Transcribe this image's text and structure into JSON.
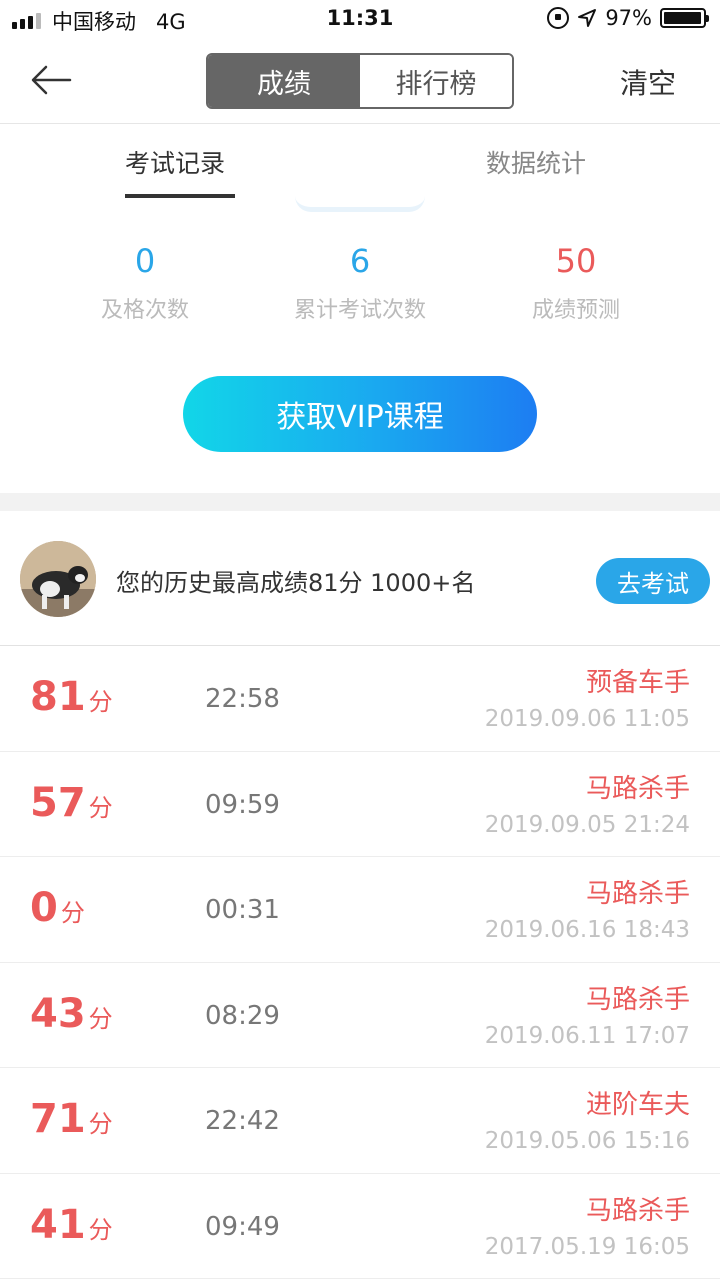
{
  "status_bar": {
    "carrier": "中国移动",
    "network": "4G",
    "time": "11:31",
    "battery_percent": "97%",
    "battery_level": 0.97
  },
  "nav": {
    "segments": [
      "成绩",
      "排行榜"
    ],
    "active_segment": 0,
    "clear_label": "清空"
  },
  "tabs": [
    "考试记录",
    "数据统计"
  ],
  "stats": [
    {
      "value": "0",
      "label": "及格次数",
      "color": "#2aa6e8"
    },
    {
      "value": "6",
      "label": "累计考试次数",
      "color": "#2aa6e8"
    },
    {
      "value": "50",
      "label": "成绩预测",
      "color": "#ea5a5a"
    }
  ],
  "vip_button": "获取VIP课程",
  "best": {
    "text": "您的历史最高成绩81分  1000+名",
    "button": "去考试"
  },
  "records": [
    {
      "score": "81",
      "unit": "分",
      "duration": "22:58",
      "title": "预备车手",
      "date": "2019.09.06 11:05"
    },
    {
      "score": "57",
      "unit": "分",
      "duration": "09:59",
      "title": "马路杀手",
      "date": "2019.09.05 21:24"
    },
    {
      "score": "0",
      "unit": "分",
      "duration": "00:31",
      "title": "马路杀手",
      "date": "2019.06.16 18:43"
    },
    {
      "score": "43",
      "unit": "分",
      "duration": "08:29",
      "title": "马路杀手",
      "date": "2019.06.11 17:07"
    },
    {
      "score": "71",
      "unit": "分",
      "duration": "22:42",
      "title": "进阶车夫",
      "date": "2019.05.06 15:16"
    },
    {
      "score": "41",
      "unit": "分",
      "duration": "09:49",
      "title": "马路杀手",
      "date": "2017.05.19 16:05"
    }
  ],
  "colors": {
    "accent_blue": "#2aa6e8",
    "score_red": "#ea5a5a",
    "segment_active": "#666666"
  }
}
